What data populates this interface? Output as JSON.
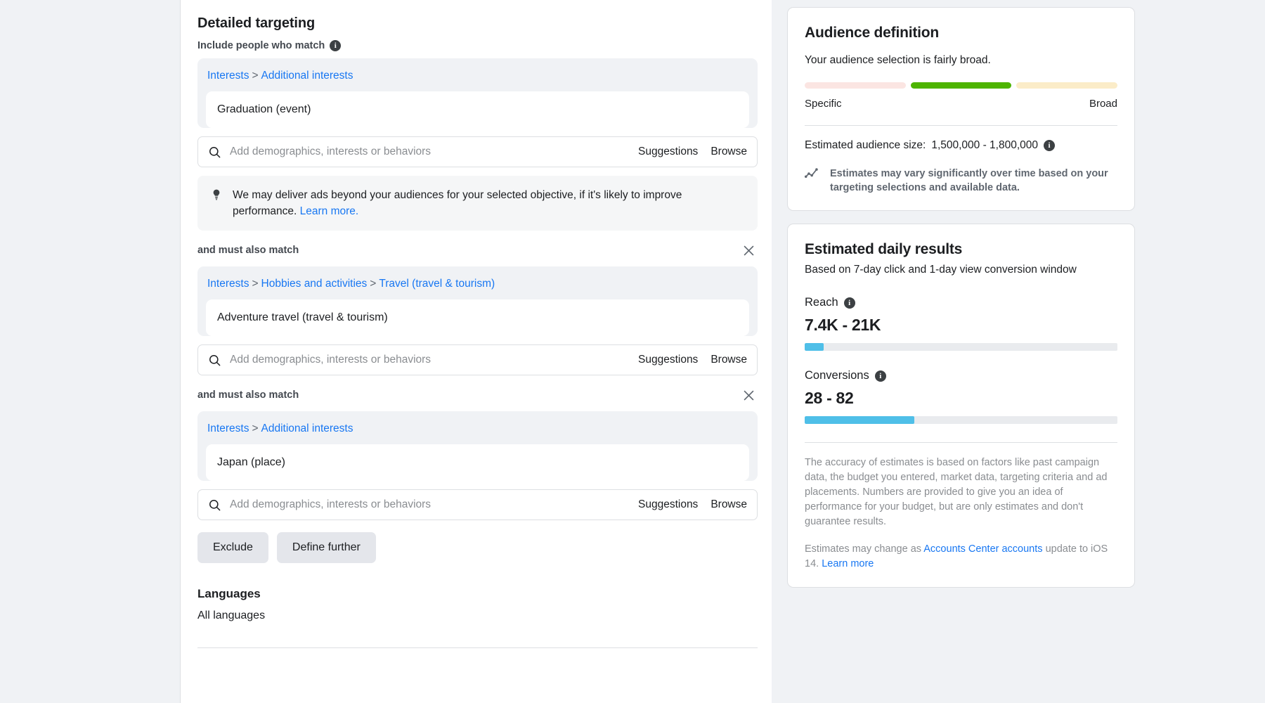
{
  "detailed_targeting": {
    "title": "Detailed targeting",
    "include_label": "Include people who match",
    "info_icon": "info-icon",
    "search_placeholder": "Add demographics, interests or behaviors",
    "suggestions_label": "Suggestions",
    "browse_label": "Browse",
    "and_must_also_match": "and must also match",
    "notice": {
      "icon": "lightbulb-icon",
      "text": "We may deliver ads beyond your audiences for your selected objective, if it's likely to improve performance.",
      "link": "Learn more."
    },
    "groups": [
      {
        "breadcrumb": [
          "Interests",
          "Additional interests"
        ],
        "selection": "Graduation (event)"
      },
      {
        "breadcrumb": [
          "Interests",
          "Hobbies and activities",
          "Travel (travel & tourism)"
        ],
        "selection": "Adventure travel (travel & tourism)"
      },
      {
        "breadcrumb": [
          "Interests",
          "Additional interests"
        ],
        "selection": "Japan (place)"
      }
    ],
    "exclude_label": "Exclude",
    "define_further_label": "Define further"
  },
  "languages": {
    "heading": "Languages",
    "value": "All languages"
  },
  "audience_definition": {
    "title": "Audience definition",
    "summary": "Your audience selection is fairly broad.",
    "gauge": {
      "segments": [
        {
          "name": "specific-segment",
          "color": "#fbe5e2",
          "active": false
        },
        {
          "name": "middle-segment",
          "color": "#4db400",
          "active": true
        },
        {
          "name": "broad-segment",
          "color": "#fbecc8",
          "active": false
        }
      ],
      "left_label": "Specific",
      "right_label": "Broad"
    },
    "estimated_size_label": "Estimated audience size:",
    "estimated_size_value": "1,500,000 - 1,800,000",
    "vary_icon": "trend-line-icon",
    "vary_note": "Estimates may vary significantly over time based on your targeting selections and available data."
  },
  "estimated_daily_results": {
    "title": "Estimated daily results",
    "subtitle": "Based on 7-day click and 1-day view conversion window",
    "metrics": [
      {
        "name": "Reach",
        "value": "7.4K - 21K",
        "bar_percent": 6,
        "bar_color": "#4fbfe8"
      },
      {
        "name": "Conversions",
        "value": "28 - 82",
        "bar_percent": 35,
        "bar_color": "#4fbfe8"
      }
    ],
    "accuracy_note": "The accuracy of estimates is based on factors like past campaign data, the budget you entered, market data, targeting criteria and ad placements. Numbers are provided to give you an idea of performance for your budget, but are only estimates and don't guarantee results.",
    "ios_note_pre": "Estimates may change as",
    "ios_note_link1": "Accounts Center accounts",
    "ios_note_mid": "update to iOS 14.",
    "ios_note_link2": "Learn more"
  }
}
